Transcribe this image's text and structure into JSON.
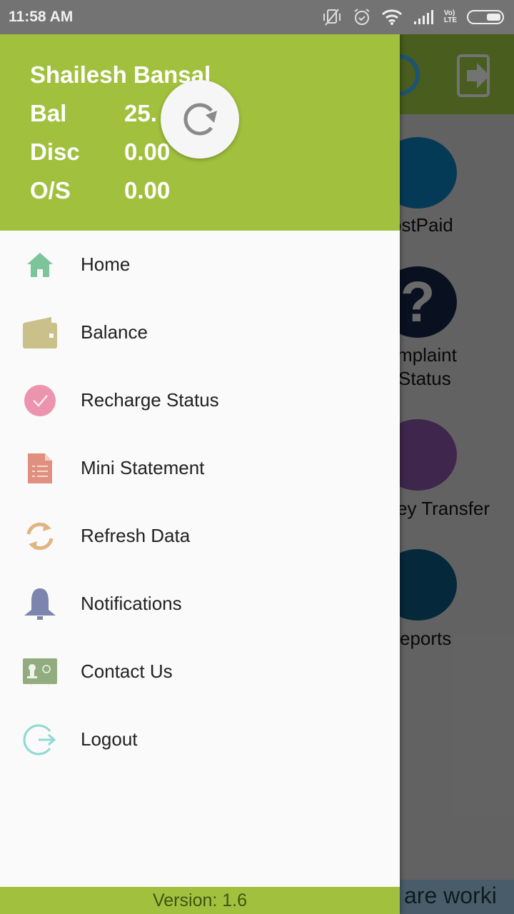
{
  "status_bar": {
    "time": "11:58 AM",
    "icons": [
      "vibrate-off-icon",
      "alarm-icon",
      "wifi-icon",
      "signal-icon",
      "volte-icon",
      "battery-icon"
    ],
    "volte_label_top": "Vo)",
    "volte_label_bottom": "LTE"
  },
  "drawer": {
    "header": {
      "user_name": "Shailesh Bansal",
      "stats": [
        {
          "label": "Bal",
          "value": "25."
        },
        {
          "label": "Disc",
          "value": "0.00"
        },
        {
          "label": "O/S",
          "value": "0.00"
        }
      ],
      "refresh_icon": "refresh-icon",
      "background_color": "#a1c03d"
    },
    "menu": [
      {
        "label": "Home",
        "icon": "home-icon",
        "color": "#7cc49a"
      },
      {
        "label": "Balance",
        "icon": "wallet-icon",
        "color": "#c9c08a"
      },
      {
        "label": "Recharge Status",
        "icon": "check-circle-icon",
        "color": "#ec93ad"
      },
      {
        "label": "Mini Statement",
        "icon": "document-icon",
        "color": "#e0907e"
      },
      {
        "label": "Refresh Data",
        "icon": "sync-icon",
        "color": "#e0b583"
      },
      {
        "label": "Notifications",
        "icon": "bell-icon",
        "color": "#7b85ad"
      },
      {
        "label": "Contact Us",
        "icon": "contact-card-icon",
        "color": "#92ac7f"
      },
      {
        "label": "Logout",
        "icon": "logout-icon",
        "color": "#8ed9d3"
      }
    ],
    "footer": {
      "version": "Version: 1.6"
    }
  },
  "background_app": {
    "tiles": [
      {
        "label": "ostPaid",
        "icon": "bill-icon",
        "color": "#0a6fa5"
      },
      {
        "label": "mplaint\nStatus",
        "line1": "mplaint",
        "line2": "Status",
        "icon": "question-icon",
        "color": "#13223f"
      },
      {
        "label": "ey Transfer",
        "icon": "money-icon",
        "color": "#7a4a94"
      },
      {
        "label": "eports",
        "icon": "report-icon",
        "color": "#0a4e6f"
      }
    ],
    "ticker_text": "are worki"
  }
}
